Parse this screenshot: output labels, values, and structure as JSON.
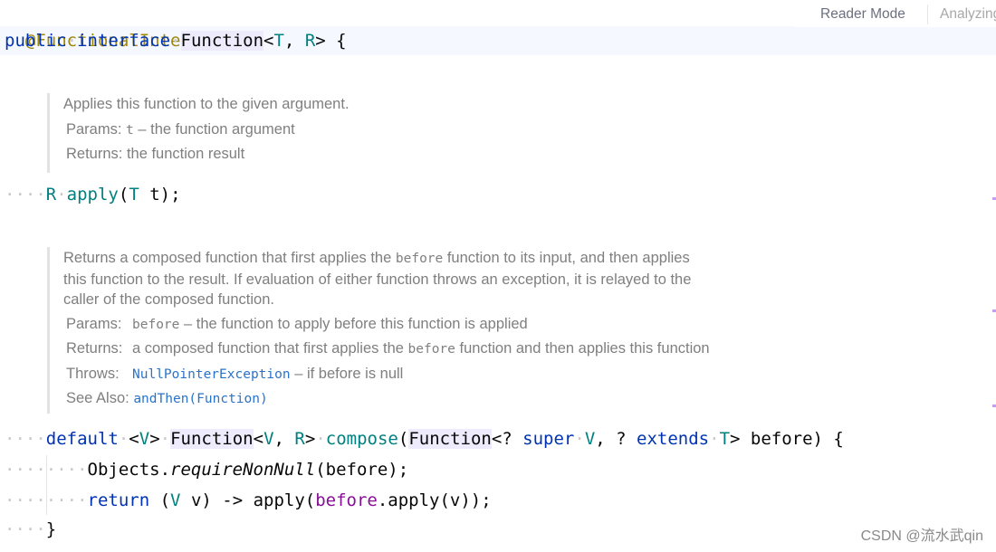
{
  "editor": {
    "reader_mode_label": "Reader Mode",
    "status_text": "Analyzing...",
    "code": {
      "annotation": "@FunctionalInterface",
      "decl": {
        "kw_public": "public",
        "kw_interface": "interface",
        "name": "Function",
        "lt": "<",
        "tp1": "T",
        "comma": ", ",
        "tp2": "R",
        "gt_brace": "> {"
      },
      "apply_line": {
        "ret": "R",
        "name": "apply",
        "open": "(",
        "ptype": "T",
        "pname": " t);"
      },
      "compose_line": {
        "kw_default": "default",
        "lt1": "<",
        "tv": "V",
        "gt1": ">",
        "fn_type": "Function",
        "lt2": "<",
        "tv2": "V",
        "c1": ", ",
        "tr": "R",
        "gt2": ">",
        "name": "compose",
        "open": "(",
        "param_type": "Function",
        "q1": "<? ",
        "kw_super": "super",
        "tv3": "V",
        "c2": ", ? ",
        "kw_extends": "extends",
        "tt": "T",
        "rest": "> before) {"
      },
      "require_line": {
        "obj": "Objects.",
        "method": "requireNonNull",
        "args": "(before);"
      },
      "return_line": {
        "kw_return": "return",
        "p_open": " (",
        "tv": "V",
        "mid": " v) -> apply(",
        "field": "before",
        "tail": ".apply(v));"
      },
      "close_brace": "}"
    },
    "docs": [
      {
        "description": [
          "Applies this function to the given argument."
        ],
        "params_label": "Params:",
        "params_code": "t",
        "params_text": " – the function argument",
        "returns_label": "Returns:",
        "returns_text": " the function result"
      },
      {
        "description_1a": "Returns a composed function that first applies the ",
        "description_1code": "before",
        "description_1b": " function to its input, and then applies",
        "description_2": "this function to the result. If evaluation of either function throws an exception, it is relayed to the",
        "description_3": "caller of the composed function.",
        "params_label": "Params:",
        "params_code": "before",
        "params_text": " – the function to apply before this function is applied",
        "returns_label": "Returns:",
        "returns_text_a": "a composed function that first applies the ",
        "returns_code": "before",
        "returns_text_b": " function and then applies this function",
        "throws_label": "Throws:",
        "throws_link": "NullPointerException",
        "throws_text": " – if before is null",
        "see_also_label": "See Also:",
        "see_also_link": "andThen(Function)"
      }
    ]
  },
  "watermark": "CSDN @流水武qin"
}
